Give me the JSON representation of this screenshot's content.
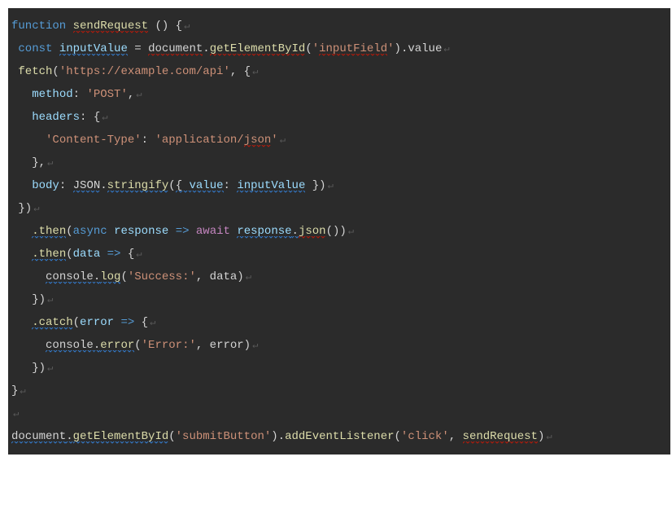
{
  "code": [
    [
      {
        "t": "function ",
        "c": "tok-keyword2"
      },
      {
        "t": "sendRequest",
        "c": "tok-func squiggle-red"
      },
      {
        "t": " () {",
        "c": "tok-punct"
      }
    ],
    [
      {
        "t": " ",
        "c": "tok-punct"
      },
      {
        "t": "const ",
        "c": "tok-keyword2"
      },
      {
        "t": "inputValue",
        "c": "tok-param squiggle-blue"
      },
      {
        "t": " = ",
        "c": "tok-punct"
      },
      {
        "t": "document",
        "c": "tok-ident squiggle-red"
      },
      {
        "t": ".",
        "c": "tok-punct"
      },
      {
        "t": "getElementById",
        "c": "tok-func squiggle-red"
      },
      {
        "t": "(",
        "c": "tok-punct"
      },
      {
        "t": "'",
        "c": "tok-string"
      },
      {
        "t": "inputField",
        "c": "tok-string squiggle-red"
      },
      {
        "t": "'",
        "c": "tok-string"
      },
      {
        "t": ").value",
        "c": "tok-punct"
      }
    ],
    [
      {
        "t": " ",
        "c": "tok-punct"
      },
      {
        "t": "fetch",
        "c": "tok-func"
      },
      {
        "t": "(",
        "c": "tok-punct"
      },
      {
        "t": "'https://example.com/api'",
        "c": "tok-string"
      },
      {
        "t": ", {",
        "c": "tok-punct"
      }
    ],
    [
      {
        "t": "   ",
        "c": "tok-punct"
      },
      {
        "t": "method",
        "c": "tok-prop"
      },
      {
        "t": ": ",
        "c": "tok-punct"
      },
      {
        "t": "'POST'",
        "c": "tok-string"
      },
      {
        "t": ",",
        "c": "tok-punct"
      }
    ],
    [
      {
        "t": "   ",
        "c": "tok-punct"
      },
      {
        "t": "headers",
        "c": "tok-prop"
      },
      {
        "t": ": {",
        "c": "tok-punct"
      }
    ],
    [
      {
        "t": "     ",
        "c": "tok-punct"
      },
      {
        "t": "'Content-Type'",
        "c": "tok-string"
      },
      {
        "t": ": ",
        "c": "tok-punct"
      },
      {
        "t": "'application/",
        "c": "tok-string"
      },
      {
        "t": "json",
        "c": "tok-string squiggle-red"
      },
      {
        "t": "'",
        "c": "tok-string"
      }
    ],
    [
      {
        "t": "   },",
        "c": "tok-punct"
      }
    ],
    [
      {
        "t": "   ",
        "c": "tok-punct"
      },
      {
        "t": "body",
        "c": "tok-prop"
      },
      {
        "t": ": ",
        "c": "tok-punct"
      },
      {
        "t": "JSON",
        "c": "tok-ident squiggle-blue"
      },
      {
        "t": ".",
        "c": "tok-punct"
      },
      {
        "t": "stringify",
        "c": "tok-func squiggle-blue"
      },
      {
        "t": "(",
        "c": "tok-punct"
      },
      {
        "t": "{ ",
        "c": "tok-punct squiggle-blue"
      },
      {
        "t": "value",
        "c": "tok-prop squiggle-blue"
      },
      {
        "t": ": ",
        "c": "tok-punct"
      },
      {
        "t": "inputValue",
        "c": "tok-param squiggle-blue"
      },
      {
        "t": " })",
        "c": "tok-punct"
      }
    ],
    [
      {
        "t": " })",
        "c": "tok-punct"
      }
    ],
    [
      {
        "t": "   ",
        "c": "tok-punct"
      },
      {
        "t": ".then",
        "c": "tok-func squiggle-blue"
      },
      {
        "t": "(",
        "c": "tok-punct"
      },
      {
        "t": "async",
        "c": "tok-keyword2"
      },
      {
        "t": " ",
        "c": "tok-punct"
      },
      {
        "t": "response",
        "c": "tok-param"
      },
      {
        "t": " ",
        "c": "tok-punct"
      },
      {
        "t": "=>",
        "c": "tok-arrow"
      },
      {
        "t": " ",
        "c": "tok-punct"
      },
      {
        "t": "await",
        "c": "tok-keyword"
      },
      {
        "t": " ",
        "c": "tok-punct"
      },
      {
        "t": "response",
        "c": "tok-param squiggle-blue"
      },
      {
        "t": ".",
        "c": "tok-punct squiggle-blue"
      },
      {
        "t": "json",
        "c": "tok-func squiggle-red"
      },
      {
        "t": "())",
        "c": "tok-punct"
      }
    ],
    [
      {
        "t": "   ",
        "c": "tok-punct"
      },
      {
        "t": ".then",
        "c": "tok-func squiggle-blue"
      },
      {
        "t": "(",
        "c": "tok-punct"
      },
      {
        "t": "data",
        "c": "tok-param"
      },
      {
        "t": " ",
        "c": "tok-punct"
      },
      {
        "t": "=>",
        "c": "tok-arrow"
      },
      {
        "t": " {",
        "c": "tok-punct"
      }
    ],
    [
      {
        "t": "     ",
        "c": "tok-punct"
      },
      {
        "t": "console",
        "c": "tok-ident squiggle-blue"
      },
      {
        "t": ".",
        "c": "tok-punct squiggle-blue"
      },
      {
        "t": "log",
        "c": "tok-func squiggle-blue"
      },
      {
        "t": "(",
        "c": "tok-punct"
      },
      {
        "t": "'Success:'",
        "c": "tok-string"
      },
      {
        "t": ", data)",
        "c": "tok-punct"
      }
    ],
    [
      {
        "t": "   })",
        "c": "tok-punct"
      }
    ],
    [
      {
        "t": "   ",
        "c": "tok-punct"
      },
      {
        "t": ".catch",
        "c": "tok-func squiggle-blue"
      },
      {
        "t": "(",
        "c": "tok-punct"
      },
      {
        "t": "error",
        "c": "tok-param"
      },
      {
        "t": " ",
        "c": "tok-punct"
      },
      {
        "t": "=>",
        "c": "tok-arrow"
      },
      {
        "t": " {",
        "c": "tok-punct"
      }
    ],
    [
      {
        "t": "     ",
        "c": "tok-punct"
      },
      {
        "t": "console",
        "c": "tok-ident squiggle-blue"
      },
      {
        "t": ".",
        "c": "tok-punct squiggle-blue"
      },
      {
        "t": "error",
        "c": "tok-func squiggle-blue"
      },
      {
        "t": "(",
        "c": "tok-punct"
      },
      {
        "t": "'Error:'",
        "c": "tok-string"
      },
      {
        "t": ", error)",
        "c": "tok-punct"
      }
    ],
    [
      {
        "t": "   })",
        "c": "tok-punct"
      }
    ],
    [
      {
        "t": "}",
        "c": "tok-punct"
      }
    ],
    [],
    [
      {
        "t": "document",
        "c": "tok-ident squiggle-blue"
      },
      {
        "t": ".",
        "c": "tok-punct squiggle-blue"
      },
      {
        "t": "getElementById",
        "c": "tok-func squiggle-blue"
      },
      {
        "t": "(",
        "c": "tok-punct"
      },
      {
        "t": "'submitButton'",
        "c": "tok-string"
      },
      {
        "t": ").",
        "c": "tok-punct"
      },
      {
        "t": "addEventListener",
        "c": "tok-func"
      },
      {
        "t": "(",
        "c": "tok-punct"
      },
      {
        "t": "'click'",
        "c": "tok-string"
      },
      {
        "t": ", ",
        "c": "tok-punct"
      },
      {
        "t": "sendRequest",
        "c": "tok-func squiggle-red"
      },
      {
        "t": ")",
        "c": "tok-punct"
      }
    ]
  ],
  "newline_glyph": "↵"
}
